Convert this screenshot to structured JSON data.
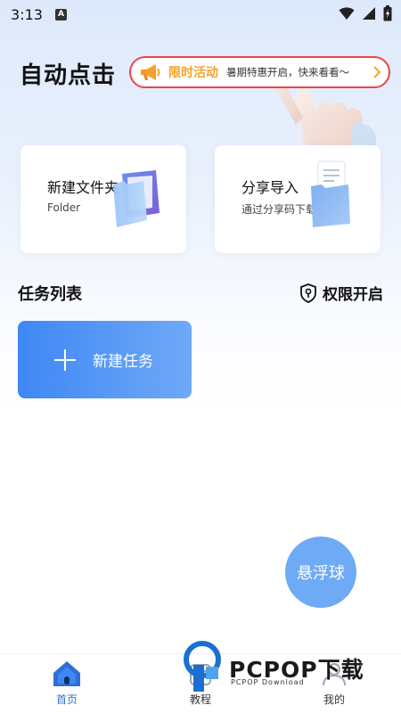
{
  "status_bar": {
    "time": "3:13",
    "notification_letter": "A",
    "icons": [
      "wifi-icon",
      "cellular-signal-icon",
      "battery-icon"
    ]
  },
  "header": {
    "title": "自动点击"
  },
  "promo": {
    "tag": "限时活动",
    "text": "暑期特惠开启，快来看看～",
    "icon": "megaphone-icon",
    "border_color": "#e94747",
    "tag_color": "#f7a12b"
  },
  "cards": [
    {
      "title": "新建文件夹",
      "subtitle": "Folder",
      "icon": "folder-icon"
    },
    {
      "title": "分享导入",
      "subtitle": "通过分享码下载",
      "icon": "document-folder-icon"
    }
  ],
  "tasks": {
    "section_title": "任务列表",
    "permission_label": "权限开启",
    "permission_icon": "shield-key-icon",
    "new_task_label": "新建任务",
    "new_task_colors": [
      "#3f87f5",
      "#6fa9f7"
    ]
  },
  "float_ball": {
    "label": "悬浮球",
    "color": "#6eaaf5"
  },
  "tabbar": {
    "items": [
      {
        "label": "首页",
        "icon": "home-icon",
        "active": true
      },
      {
        "label": "教程",
        "icon": "tutorial-icon",
        "active": false
      },
      {
        "label": "我的",
        "icon": "profile-icon",
        "active": false
      }
    ],
    "active_color": "#2f6fd6"
  },
  "watermark": {
    "brand": "PCPOP下载",
    "subtitle": "PCPOP Download"
  }
}
